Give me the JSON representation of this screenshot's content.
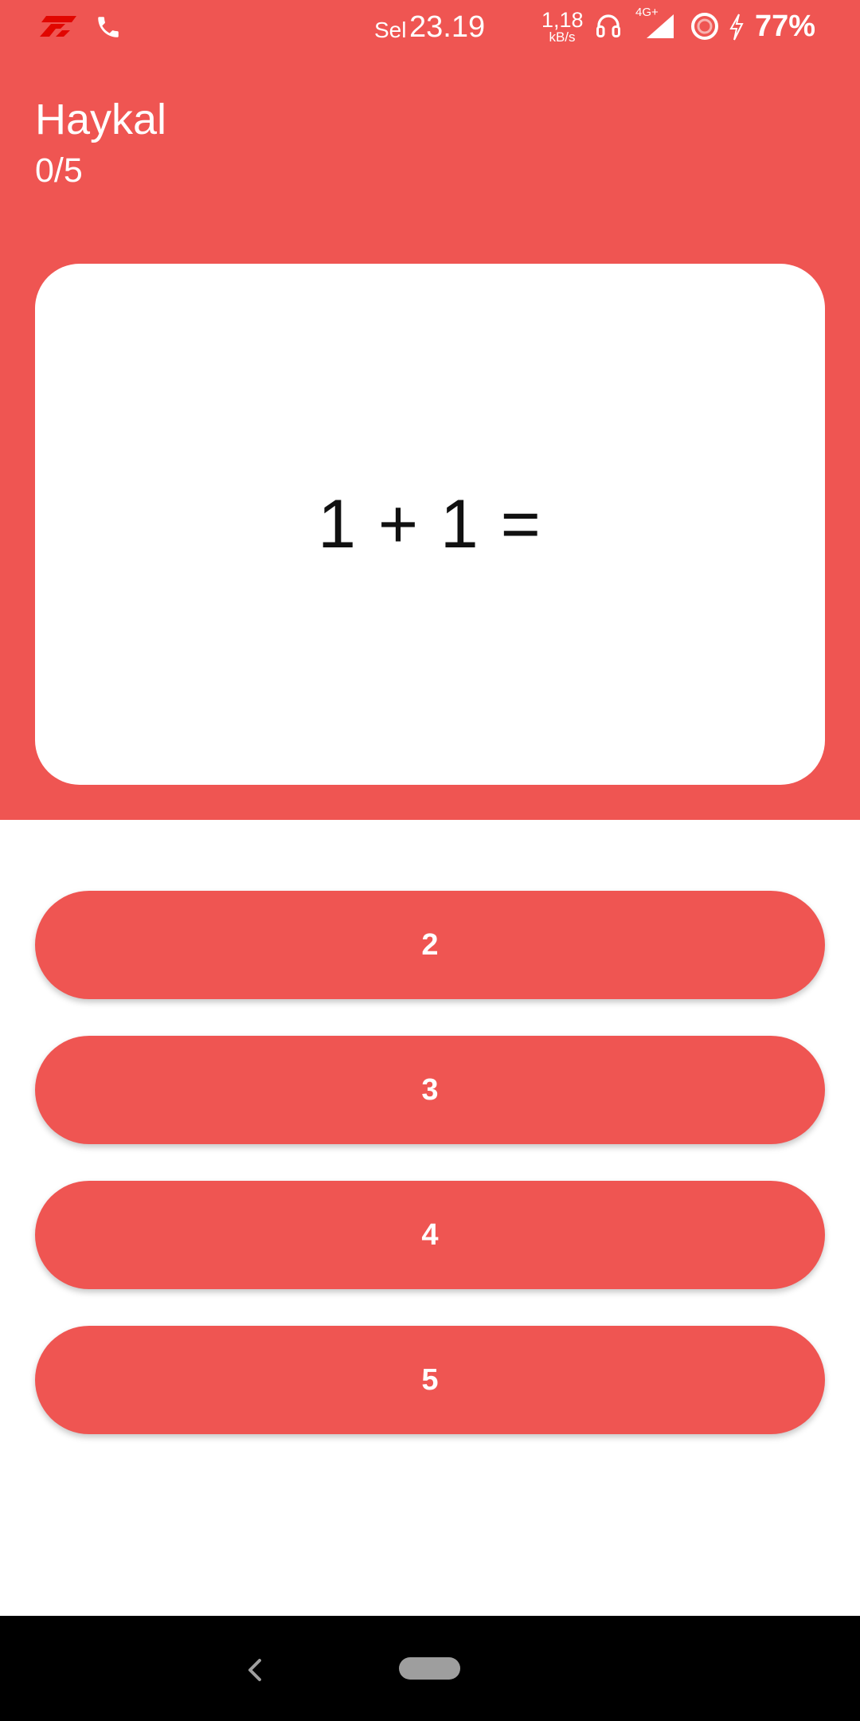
{
  "status_bar": {
    "day": "Sel",
    "time": "23.19",
    "net_speed_value": "1,18",
    "net_speed_unit": "kB/s",
    "network_type": "4G+",
    "battery": "77%",
    "icons": [
      "f1-logo-icon",
      "phone-icon",
      "headset-icon",
      "signal-icon",
      "ring-icon",
      "charging-bolt-icon"
    ]
  },
  "header": {
    "player_name": "Haykal",
    "score": "0/5"
  },
  "question": {
    "text": "1 + 1 ="
  },
  "answers": [
    "2",
    "3",
    "4",
    "5"
  ],
  "nav_bar": {
    "icons": [
      "back-icon",
      "home-pill"
    ]
  },
  "colors": {
    "primary": "#EF5552",
    "surface": "#FFFFFF",
    "nav_background": "#000000"
  }
}
